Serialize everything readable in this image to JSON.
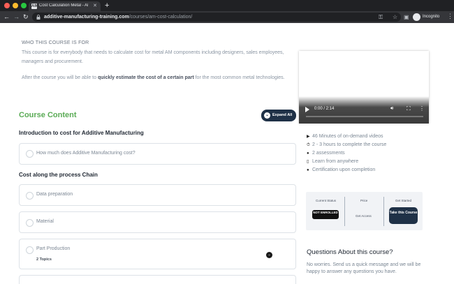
{
  "browser": {
    "tab_title": "Cost Calculation Metal - AMPO",
    "tab_favicon": "AM",
    "close_glyph": "✕",
    "newtab_glyph": "+",
    "url_host": "additive-manufacturing-training.com",
    "url_path": "/courses/am-cost-calculation/",
    "profile_label": "Incognito"
  },
  "page": {
    "who_heading": "WHO THIS COURSE IS FOR",
    "who_text": "This course is for everybody that needs to calculate cost for metal AM components including designers, sales employees, managers and procurement.",
    "after_prefix": "After the course you will be able to ",
    "after_bold": "quickly estimate the cost of a certain part",
    "after_suffix": " for the most common metal technologies."
  },
  "content": {
    "title": "Course Content",
    "expand_label": "Expand All",
    "sections": [
      {
        "title": "Introduction to cost for Additive Manufacturing",
        "lessons": [
          {
            "label": "How much does Additive Manufacturing cost?"
          }
        ]
      },
      {
        "title": "Cost along the process Chain",
        "lessons": [
          {
            "label": "Data preparation"
          },
          {
            "label": "Material"
          },
          {
            "label": "Part Production",
            "sub": "2 Topics"
          }
        ]
      }
    ]
  },
  "video": {
    "time": "0:00 / 2:14",
    "progress": 0
  },
  "features": [
    {
      "icon": "video-icon",
      "text": "46 Minutes of on-demand videos"
    },
    {
      "icon": "stopwatch-icon",
      "text": "2 - 3 hours to complete the course"
    },
    {
      "icon": "question-icon",
      "text": "2 assessments"
    },
    {
      "icon": "mobile-icon",
      "text": "Learn from anywhere"
    },
    {
      "icon": "certificate-icon",
      "text": "Certification upon completion"
    }
  ],
  "enroll": {
    "status_header": "Current Status",
    "status_value": "NOT ENROLLED",
    "price_header": "Price",
    "price_value": "Get Access",
    "start_header": "Get Started",
    "take_label": "Take this Course"
  },
  "questions": {
    "title": "Questions About this course?",
    "text": "No worries. Send us a quick message and we will be happy to answer any questions you have."
  },
  "colors": {
    "accent_green": "#5aab55",
    "navy": "#1f3147"
  }
}
